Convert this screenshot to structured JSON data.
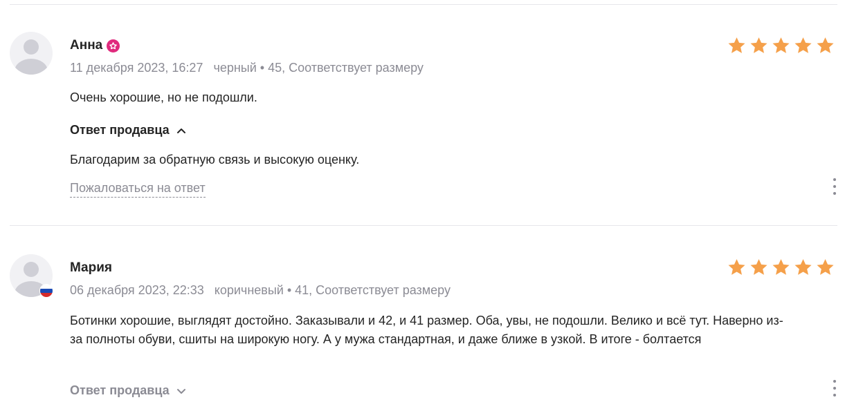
{
  "colors": {
    "star": "#f5a04a",
    "badge": "#e02a7d",
    "muted_text": "#8b8b94",
    "primary_text": "#242424",
    "divider": "#e6e6ea"
  },
  "reviews": [
    {
      "author": "Анна",
      "badge_icon": "pink-star-badge-icon",
      "date": "11 декабря 2023, 16:27",
      "details": "черный • 45, Соответствует размеру",
      "rating": 5,
      "text": "Очень хорошие, но не подошли.",
      "seller_reply": {
        "label": "Ответ продавца",
        "state": "expanded",
        "text": "Благодарим за обратную связь и высокую оценку.",
        "complain_label": "Пожаловаться на ответ"
      },
      "more_icon": "kebab-menu-icon"
    },
    {
      "author": "Мария",
      "flag_icon": "russia-flag-icon",
      "date": "06 декабря 2023, 22:33",
      "details": "коричневый • 41, Соответствует размеру",
      "rating": 5,
      "text": "Ботинки хорошие, выглядят достойно. Заказывали и 42, и 41 размер. Оба, увы, не подошли. Велико и всё тут. Наверно из-за полноты обуви, сшиты на широкую ногу. А у мужа стандартная, и даже ближе в узкой. В итоге - болтается",
      "seller_reply": {
        "label": "Ответ продавца",
        "state": "collapsed"
      },
      "more_icon": "kebab-menu-icon"
    }
  ]
}
